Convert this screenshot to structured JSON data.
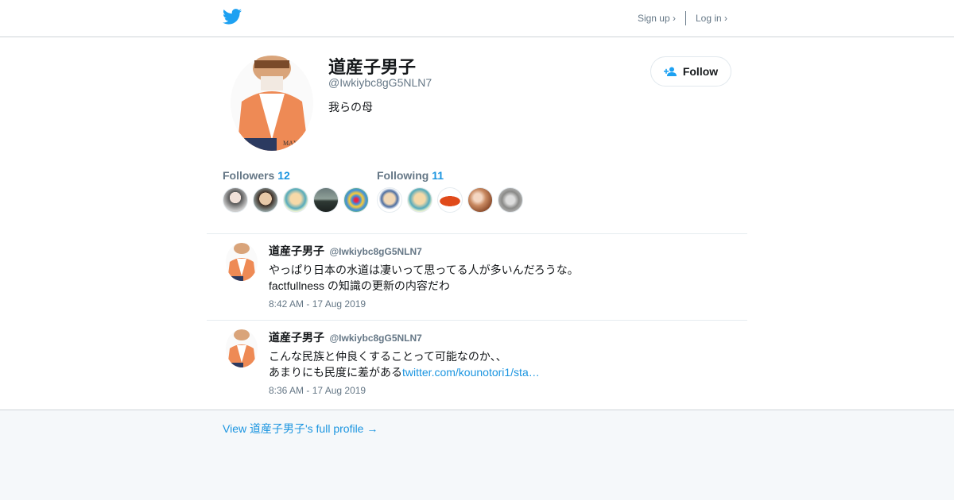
{
  "header": {
    "logo_icon": "twitter-bird-icon",
    "signup_label": "Sign up ›",
    "login_label": "Log in ›",
    "brand_color": "#1da1f2"
  },
  "profile": {
    "name": "道産子男子",
    "handle": "@Iwkiybc8gG5NLN7",
    "bio": "我らの母",
    "follow_label": "Follow",
    "follow_icon": "add-person-icon",
    "avatar_text": "MAX&Co.",
    "followers_label": "Followers",
    "followers_count": "12",
    "following_label": "Following",
    "following_count": "11"
  },
  "tweets": [
    {
      "name": "道産子男子",
      "handle": "@Iwkiybc8gG5NLN7",
      "line1": "やっぱり日本の水道は凄いって思ってる人が多いんだろうな。",
      "line2": "factfullness の知識の更新の内容だわ",
      "time": "8:42 AM - 17 Aug 2019"
    },
    {
      "name": "道産子男子",
      "handle": "@Iwkiybc8gG5NLN7",
      "line1": "こんな民族と仲良くすることって可能なのか、、",
      "line2": "あまりにも民度に差がある",
      "link": "twitter.com/kounotori1/sta…",
      "time": "8:36 AM - 17 Aug 2019"
    }
  ],
  "footer": {
    "view_full_label": "View 道産子男子's full profile →"
  },
  "colors": {
    "accent": "#1b95e0",
    "muted": "#657786",
    "background": "#f5f8fa"
  }
}
